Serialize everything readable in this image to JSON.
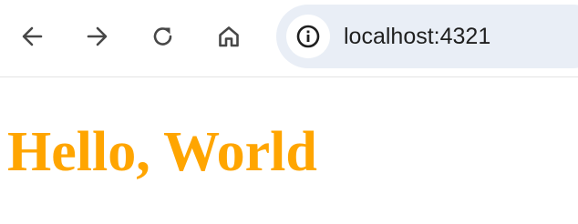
{
  "toolbar": {
    "buttons": [
      {
        "name": "back",
        "icon": "arrow-left-icon"
      },
      {
        "name": "forward",
        "icon": "arrow-right-icon"
      },
      {
        "name": "reload",
        "icon": "reload-icon"
      },
      {
        "name": "home",
        "icon": "home-icon"
      }
    ],
    "site_info_icon": "info-icon",
    "url": "localhost:4321"
  },
  "page": {
    "heading": "Hello, World"
  },
  "colors": {
    "heading": "#ffa500",
    "omnibox_bg": "#e9eef6",
    "icon": "#474747"
  }
}
